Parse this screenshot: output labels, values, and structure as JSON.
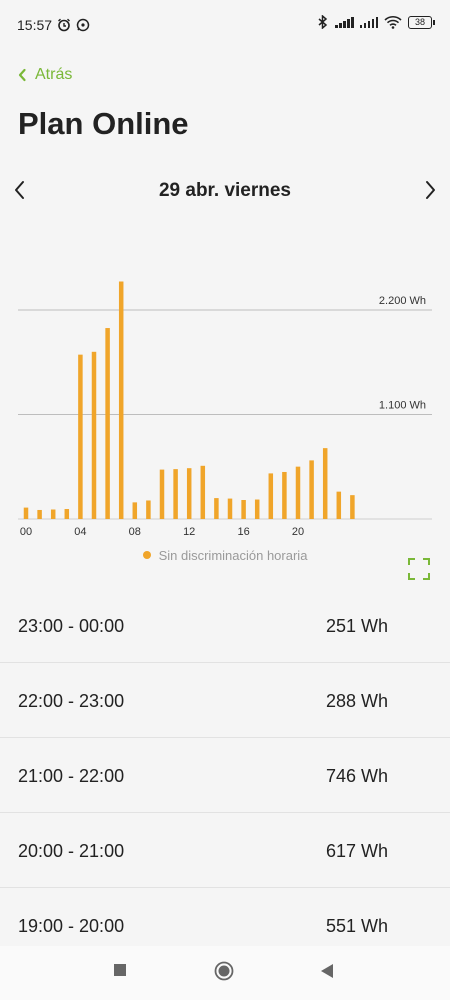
{
  "status_bar": {
    "time": "15:57",
    "battery": "38"
  },
  "header": {
    "back_label": "Atrás",
    "title": "Plan Online"
  },
  "date_nav": {
    "date": "29 abr. viernes"
  },
  "chart_data": {
    "type": "bar",
    "categories": [
      "00",
      "01",
      "02",
      "03",
      "04",
      "05",
      "06",
      "07",
      "08",
      "09",
      "10",
      "11",
      "12",
      "13",
      "14",
      "15",
      "16",
      "17",
      "18",
      "19",
      "20",
      "21",
      "22",
      "23"
    ],
    "x_tick_labels": [
      "00",
      "04",
      "08",
      "12",
      "16",
      "20"
    ],
    "values": [
      120,
      95,
      100,
      105,
      1730,
      1760,
      2010,
      2500,
      175,
      195,
      520,
      525,
      535,
      560,
      220,
      215,
      200,
      205,
      480,
      495,
      551,
      617,
      746,
      288,
      251
    ],
    "gridlines": [
      {
        "value": 1100,
        "label": "1.100 Wh"
      },
      {
        "value": 2200,
        "label": "2.200 Wh"
      }
    ],
    "ylim": [
      0,
      2900
    ],
    "color": "#f0a52a",
    "legend": "Sin discriminación horaria"
  },
  "list": [
    {
      "range": "23:00 - 00:00",
      "value": "251 Wh"
    },
    {
      "range": "22:00 - 23:00",
      "value": "288 Wh"
    },
    {
      "range": "21:00 - 22:00",
      "value": "746 Wh"
    },
    {
      "range": "20:00 - 21:00",
      "value": "617 Wh"
    },
    {
      "range": "19:00 - 20:00",
      "value": "551 Wh"
    }
  ],
  "colors": {
    "accent": "#7ab838",
    "bar": "#f0a52a"
  }
}
